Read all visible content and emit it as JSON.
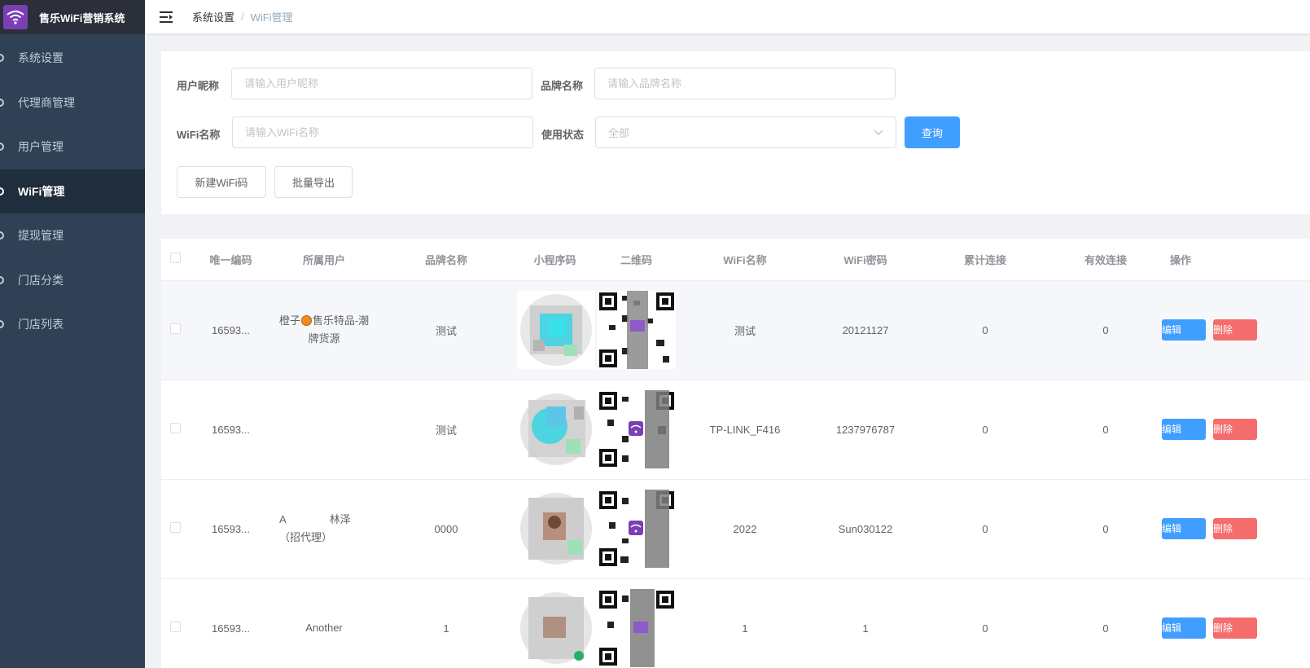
{
  "app": {
    "title": "售乐WiFi营销系统",
    "logo_icon": "wifi-icon",
    "accent": "#409eff",
    "danger": "#f56c6c",
    "sidebar_bg": "#304156"
  },
  "sidebar": {
    "items": [
      {
        "label": "系统设置",
        "icon": "gear-icon",
        "active": false
      },
      {
        "label": "代理商管理",
        "icon": "gear-icon",
        "active": false
      },
      {
        "label": "用户管理",
        "icon": "gear-icon",
        "active": false
      },
      {
        "label": "WiFi管理",
        "icon": "gear-icon",
        "active": true
      },
      {
        "label": "提现管理",
        "icon": "gear-icon",
        "active": false
      },
      {
        "label": "门店分类",
        "icon": "gear-icon",
        "active": false
      },
      {
        "label": "门店列表",
        "icon": "gear-icon",
        "active": false
      }
    ]
  },
  "header": {
    "toggle_icon": "menu-fold-icon",
    "breadcrumb": [
      "系统设置",
      "WiFi管理"
    ],
    "separator": "/"
  },
  "filters": {
    "nickname": {
      "label": "用户昵称",
      "placeholder": "请输入用户昵称",
      "value": ""
    },
    "brand": {
      "label": "品牌名称",
      "placeholder": "请输入品牌名称",
      "value": ""
    },
    "wifi_name": {
      "label": "WiFi名称",
      "placeholder": "请输入WiFi名称",
      "value": ""
    },
    "status": {
      "label": "使用状态",
      "selected": "全部"
    },
    "search_label": "查询",
    "create_label": "新建WiFi码",
    "export_label": "批量导出"
  },
  "table": {
    "columns": [
      "唯一编码",
      "所属用户",
      "品牌名称",
      "小程序码",
      "二维码",
      "WiFi名称",
      "WiFi密码",
      "累计连接",
      "有效连接",
      "操作"
    ],
    "edit_label": "编辑",
    "delete_label": "删除",
    "rows": [
      {
        "code": "16593...",
        "user_a": "橙子",
        "user_b": "售乐特品-潮牌货源",
        "brand": "测试",
        "wifi": "测试",
        "password": "20121127",
        "total": "0",
        "valid": "0"
      },
      {
        "code": "16593...",
        "user_a": "",
        "user_b": "",
        "brand": "测试",
        "wifi": "TP-LINK_F416",
        "password": "1237976787",
        "total": "0",
        "valid": "0"
      },
      {
        "code": "16593...",
        "user_a": "A",
        "user_b": "林泽（招代理）",
        "brand": "0000",
        "wifi": "2022",
        "password": "Sun030122",
        "total": "0",
        "valid": "0"
      },
      {
        "code": "16593...",
        "user_a": "",
        "user_b": "Another",
        "brand": "1",
        "wifi": "1",
        "password": "1",
        "total": "0",
        "valid": "0"
      }
    ]
  }
}
